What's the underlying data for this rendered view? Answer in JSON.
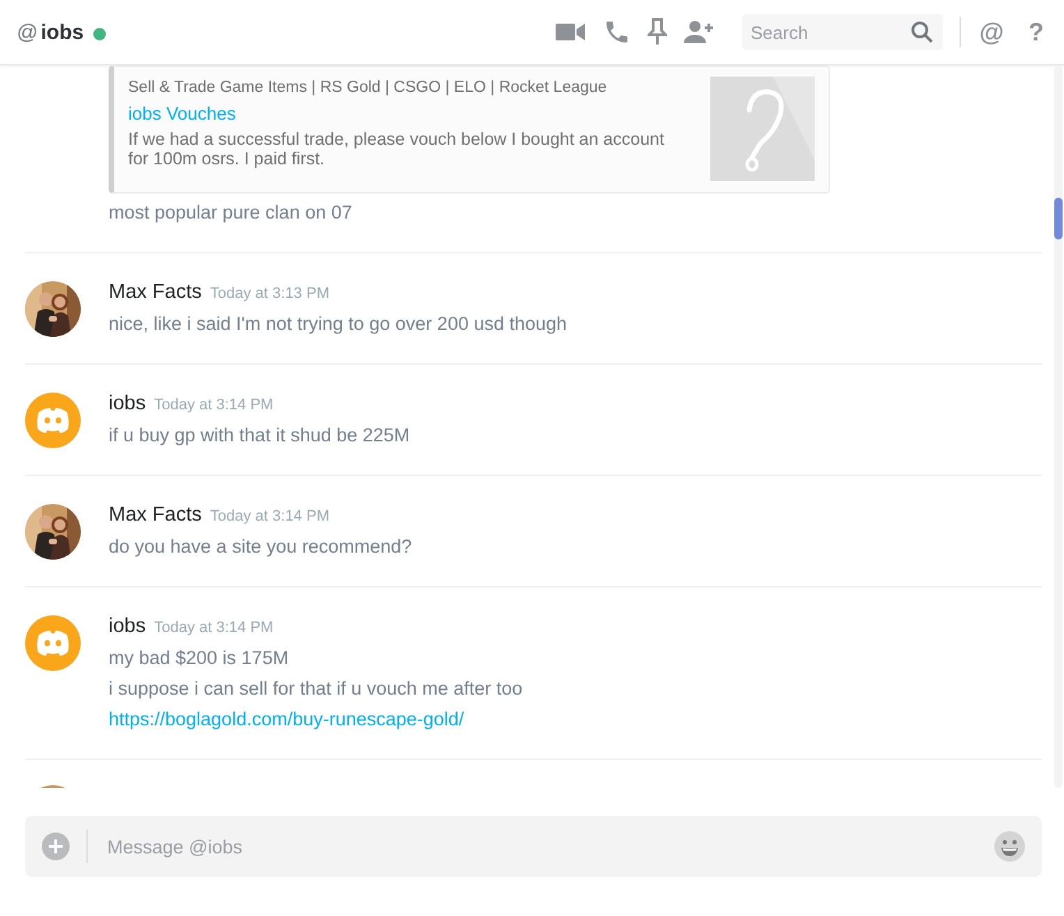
{
  "header": {
    "prefix": "@",
    "name": "iobs",
    "online": true,
    "search_placeholder": "Search",
    "mentions": "@",
    "help": "?"
  },
  "messages": [
    {
      "kind": "continuation",
      "embed": {
        "provider": "Sell & Trade Game Items | RS Gold | CSGO | ELO | Rocket League",
        "title": "iobs Vouches",
        "description": "If we had a successful trade, please vouch below I bought an account for 100m osrs. I paid first."
      },
      "lines": [
        {
          "kind": "text",
          "text": "most popular pure clan on 07"
        }
      ]
    },
    {
      "kind": "group",
      "author": "Max Facts",
      "time": "Today at 3:13 PM",
      "lines": [
        {
          "kind": "text",
          "text": "nice, like i said I'm not trying to go over 200 usd though"
        }
      ]
    },
    {
      "kind": "group",
      "avatar": {
        "kind": "default"
      },
      "author": "iobs",
      "time": "Today at 3:14 PM",
      "lines": [
        {
          "kind": "text",
          "text": "if u buy gp with that it shud be 225M"
        }
      ]
    },
    {
      "kind": "group",
      "author": "Max Facts",
      "time": "Today at 3:14 PM",
      "lines": [
        {
          "kind": "text",
          "text": "do you have a site you recommend?"
        }
      ]
    },
    {
      "kind": "group",
      "avatar": {
        "kind": "default"
      },
      "author": "iobs",
      "time": "Today at 3:14 PM",
      "lines": [
        {
          "kind": "text",
          "text": "my bad $200 is 175M"
        },
        {
          "kind": "text",
          "text": "i suppose i can sell for that if u vouch me after too"
        },
        {
          "kind": "link",
          "text": "https://boglagold.com/buy-runescape-gold/"
        }
      ]
    },
    {
      "kind": "cut"
    }
  ],
  "composer": {
    "placeholder": "Message @iobs"
  }
}
